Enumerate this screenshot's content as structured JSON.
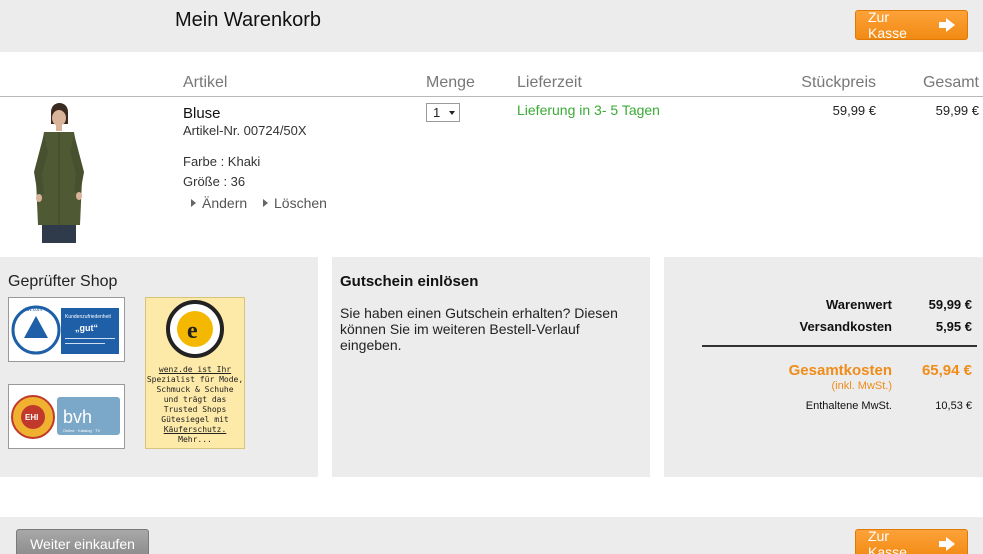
{
  "header": {
    "title": "Mein Warenkorb",
    "checkout_label": "Zur Kasse"
  },
  "columns": {
    "article": "Artikel",
    "quantity": "Menge",
    "delivery": "Lieferzeit",
    "unit_price": "Stückpreis",
    "total": "Gesamt"
  },
  "item": {
    "name": "Bluse",
    "article_no": "Artikel-Nr. 00724/50X",
    "color": "Farbe : Khaki",
    "size": "Größe : 36",
    "edit_label": "Ändern",
    "delete_label": "Löschen",
    "quantity": "1",
    "delivery": "Lieferung in 3- 5 Tagen",
    "unit_price": "59,99 €",
    "total_price": "59,99 €"
  },
  "shop_panel": {
    "title": "Geprüfter Shop",
    "tuv": {
      "brand": "tuv.com",
      "heading": "Kundenzufriedenheit",
      "grade": "„gut“"
    },
    "ehi": {
      "seal": "EHI",
      "text": "bvh",
      "sub": "Online · Katalog · TV"
    },
    "trusted": {
      "logo": "e",
      "lines": [
        "wenz.de ist Ihr",
        "Spezialist für Mode,",
        "Schmuck & Schuhe",
        "und trägt das",
        "Trusted Shops",
        "Gütesiegel mit",
        "Käuferschutz.",
        "Mehr..."
      ]
    }
  },
  "voucher": {
    "title": "Gutschein einlösen",
    "text": "Sie haben einen Gutschein erhalten? Diesen können Sie im weiteren Bestell-Verlauf eingeben."
  },
  "totals": {
    "goods_label": "Warenwert",
    "goods_value": "59,99 €",
    "shipping_label": "Versandkosten",
    "shipping_value": "5,95 €",
    "grand_label": "Gesamtkosten",
    "grand_value": "65,94 €",
    "incl_vat": "(inkl. MwSt.)",
    "vat_label": "Enthaltene MwSt.",
    "vat_value": "10,53 €"
  },
  "footer": {
    "continue_label": "Weiter einkaufen",
    "checkout_label": "Zur Kasse"
  },
  "colors": {
    "accent": "#f5931f",
    "success": "#3aaa35",
    "panel_bg": "#ececec"
  },
  "icons": {
    "checkout_arrow": "arrow-right-icon",
    "link_bullet": "triangle-right-icon",
    "select_caret": "caret-down-icon"
  }
}
